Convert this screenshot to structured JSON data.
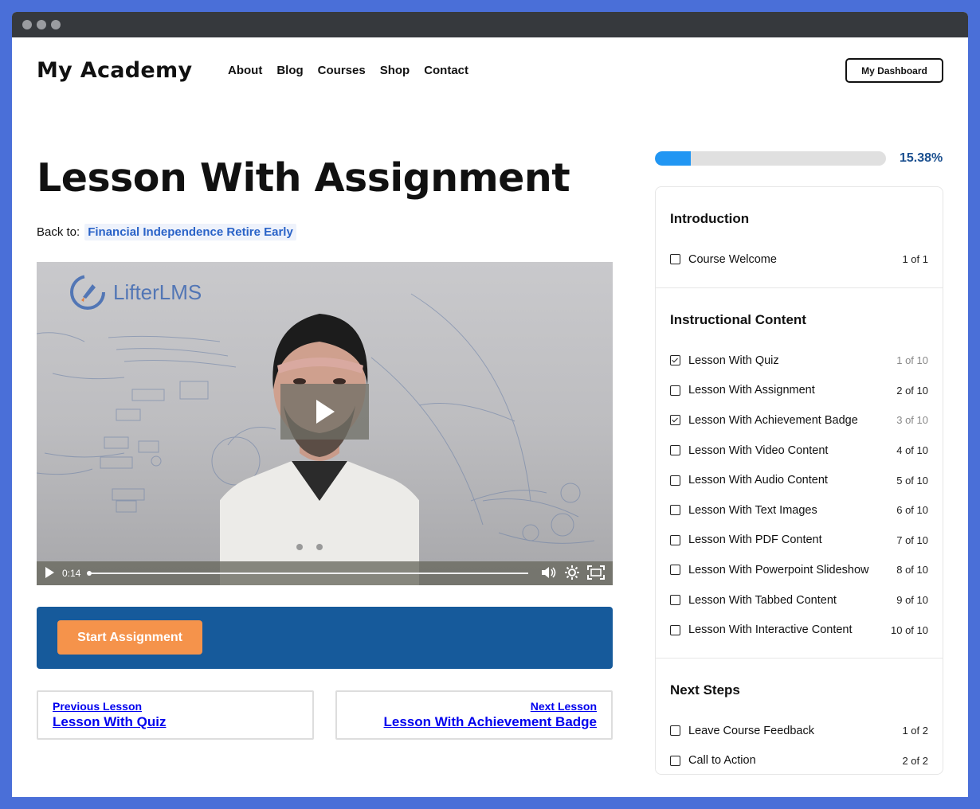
{
  "browser": {
    "dots": 3
  },
  "header": {
    "logo": "My Academy",
    "nav": [
      "About",
      "Blog",
      "Courses",
      "Shop",
      "Contact"
    ],
    "dashboard_button": "My Dashboard"
  },
  "lesson": {
    "title": "Lesson With Assignment",
    "back_to_label": "Back to:",
    "back_to_link": "Financial Independence Retire Early"
  },
  "video": {
    "brand_text": "LifterLMS",
    "current_time": "0:14",
    "icons": [
      "play-icon",
      "volume-icon",
      "settings-gear-icon",
      "fullscreen-icon"
    ]
  },
  "assignment": {
    "start_button": "Start Assignment"
  },
  "lesson_nav": {
    "previous": {
      "label": "Previous Lesson",
      "name": "Lesson With Quiz"
    },
    "next": {
      "label": "Next Lesson",
      "name": "Lesson With Achievement Badge"
    }
  },
  "progress": {
    "percent": 15.38,
    "label": "15.38%",
    "color": "#2196f3"
  },
  "syllabus": {
    "sections": [
      {
        "title": "Introduction",
        "items": [
          {
            "name": "Course Welcome",
            "count": "1 of 1",
            "complete": false
          }
        ]
      },
      {
        "title": "Instructional Content",
        "items": [
          {
            "name": "Lesson With Quiz",
            "count": "1 of 10",
            "complete": true
          },
          {
            "name": "Lesson With Assignment",
            "count": "2 of 10",
            "complete": false
          },
          {
            "name": "Lesson With Achievement Badge",
            "count": "3 of 10",
            "complete": true
          },
          {
            "name": "Lesson With Video Content",
            "count": "4 of 10",
            "complete": false
          },
          {
            "name": "Lesson With Audio Content",
            "count": "5 of 10",
            "complete": false
          },
          {
            "name": "Lesson With Text Images",
            "count": "6 of 10",
            "complete": false
          },
          {
            "name": "Lesson With PDF Content",
            "count": "7 of 10",
            "complete": false
          },
          {
            "name": "Lesson With Powerpoint Slideshow",
            "count": "8 of 10",
            "complete": false
          },
          {
            "name": "Lesson With Tabbed Content",
            "count": "9 of 10",
            "complete": false
          },
          {
            "name": "Lesson With Interactive Content",
            "count": "10 of 10",
            "complete": false
          }
        ]
      },
      {
        "title": "Next Steps",
        "items": [
          {
            "name": "Leave Course Feedback",
            "count": "1 of 2",
            "complete": false
          },
          {
            "name": "Call to Action",
            "count": "2 of 2",
            "complete": false
          }
        ]
      }
    ]
  }
}
